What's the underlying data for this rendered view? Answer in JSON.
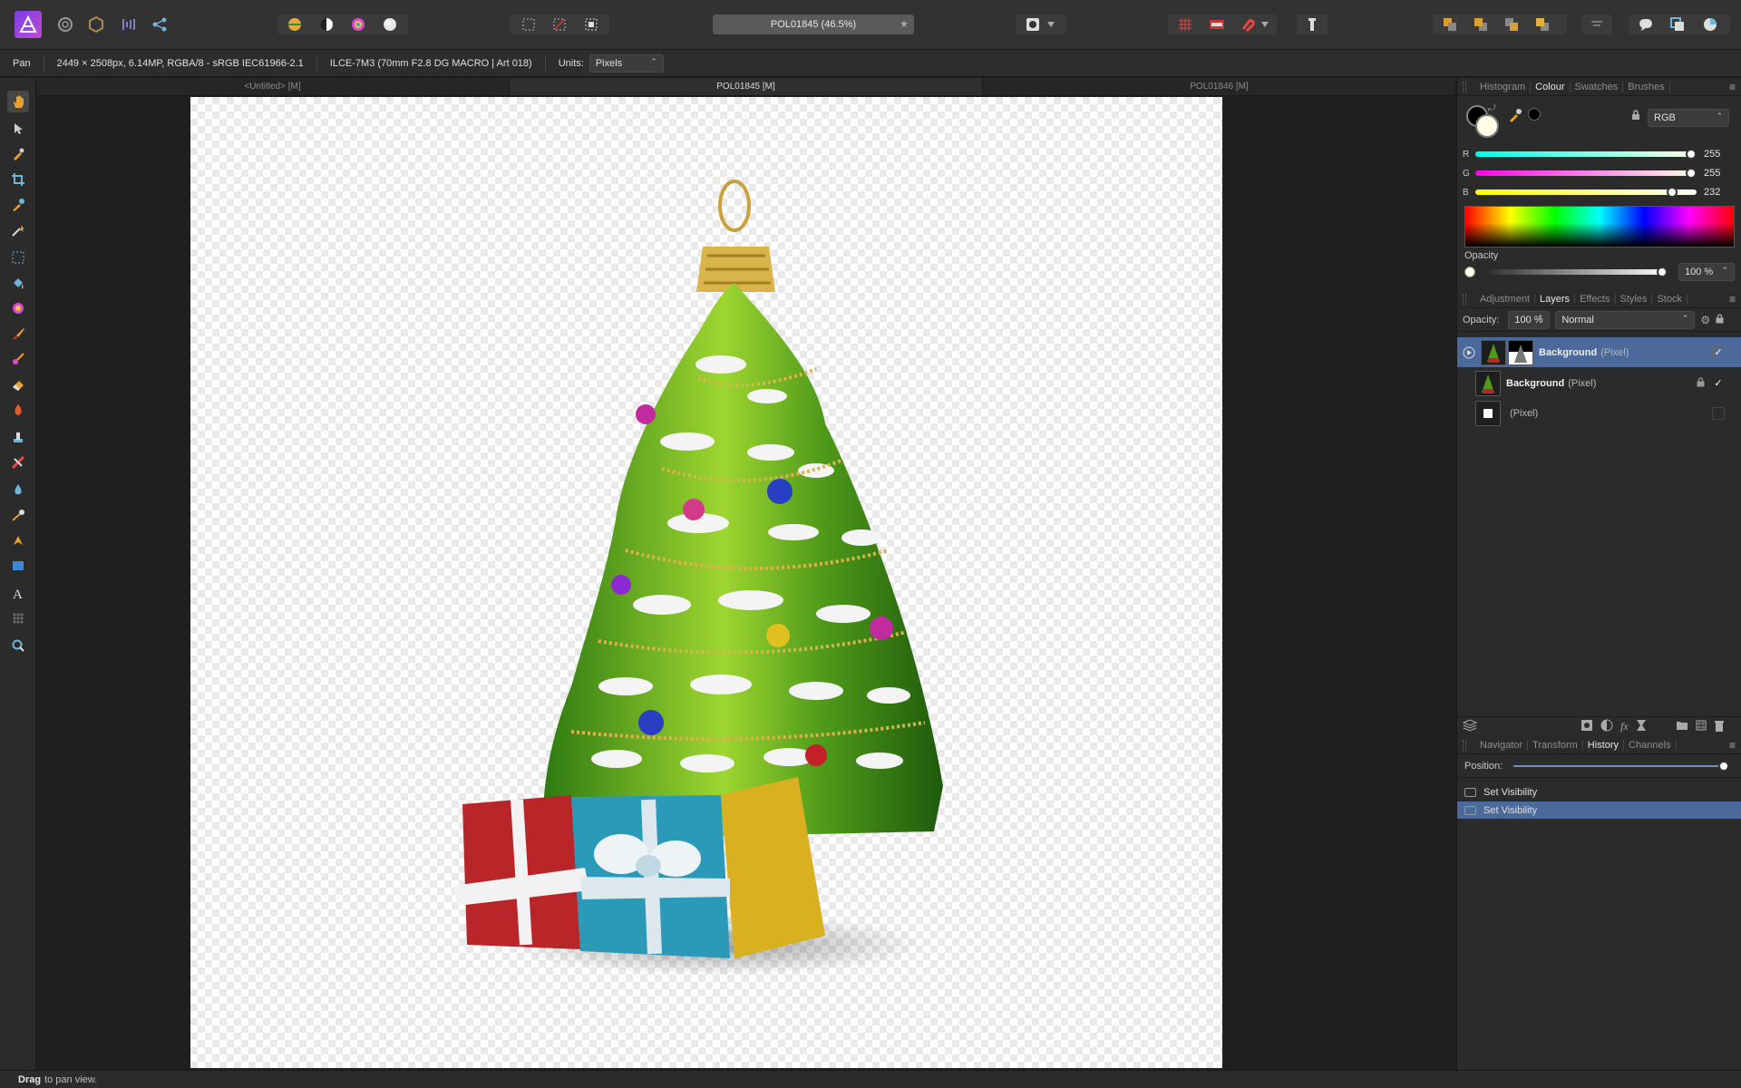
{
  "toolbar": {
    "document_title": "POL01845 (46.5%)",
    "star": "★"
  },
  "context": {
    "tool": "Pan",
    "doc_info": "2449 × 2508px, 6.14MP, RGBA/8 - sRGB IEC61966-2.1",
    "camera": "ILCE-7M3 (70mm F2.8 DG MACRO | Art 018)",
    "units_label": "Units:",
    "units_value": "Pixels"
  },
  "doc_tabs": [
    {
      "label": "<Untitled> [M]"
    },
    {
      "label": "POL01845 [M]"
    },
    {
      "label": "POL01846 [M]"
    }
  ],
  "status": {
    "bold": "Drag",
    "text": "to pan view."
  },
  "colour_panel": {
    "tabs": [
      "Histogram",
      "Colour",
      "Swatches",
      "Brushes"
    ],
    "active_tab": "Colour",
    "model": "RGB",
    "r_label": "R",
    "r_value": "255",
    "g_label": "G",
    "g_value": "255",
    "b_label": "B",
    "b_value": "232",
    "r": 255,
    "g": 255,
    "b": 232,
    "opacity_label": "Opacity",
    "opacity_value": "100 %",
    "opacity_fraction": 1.0,
    "fill_color": "#ffffe8"
  },
  "layers_panel": {
    "tabs": [
      "Adjustment",
      "Layers",
      "Effects",
      "Styles",
      "Stock"
    ],
    "active_tab": "Layers",
    "opacity_label": "Opacity:",
    "opacity_value": "100 %",
    "blend_mode": "Normal",
    "layers": [
      {
        "name": "Background",
        "type": "(Pixel)",
        "selected": true,
        "visible": true,
        "locked": false
      },
      {
        "name": "Background",
        "type": "(Pixel)",
        "selected": false,
        "visible": true,
        "locked": true
      },
      {
        "name": "",
        "type": "(Pixel)",
        "selected": false,
        "visible": false,
        "locked": false
      }
    ]
  },
  "history_panel": {
    "tabs": [
      "Navigator",
      "Transform",
      "History",
      "Channels"
    ],
    "active_tab": "History",
    "position_label": "Position:",
    "position_fraction": 1.0,
    "items": [
      {
        "label": "Set Visibility",
        "selected": false
      },
      {
        "label": "Set Visibility",
        "selected": true
      }
    ]
  },
  "accent_color": "#4b6a9b"
}
